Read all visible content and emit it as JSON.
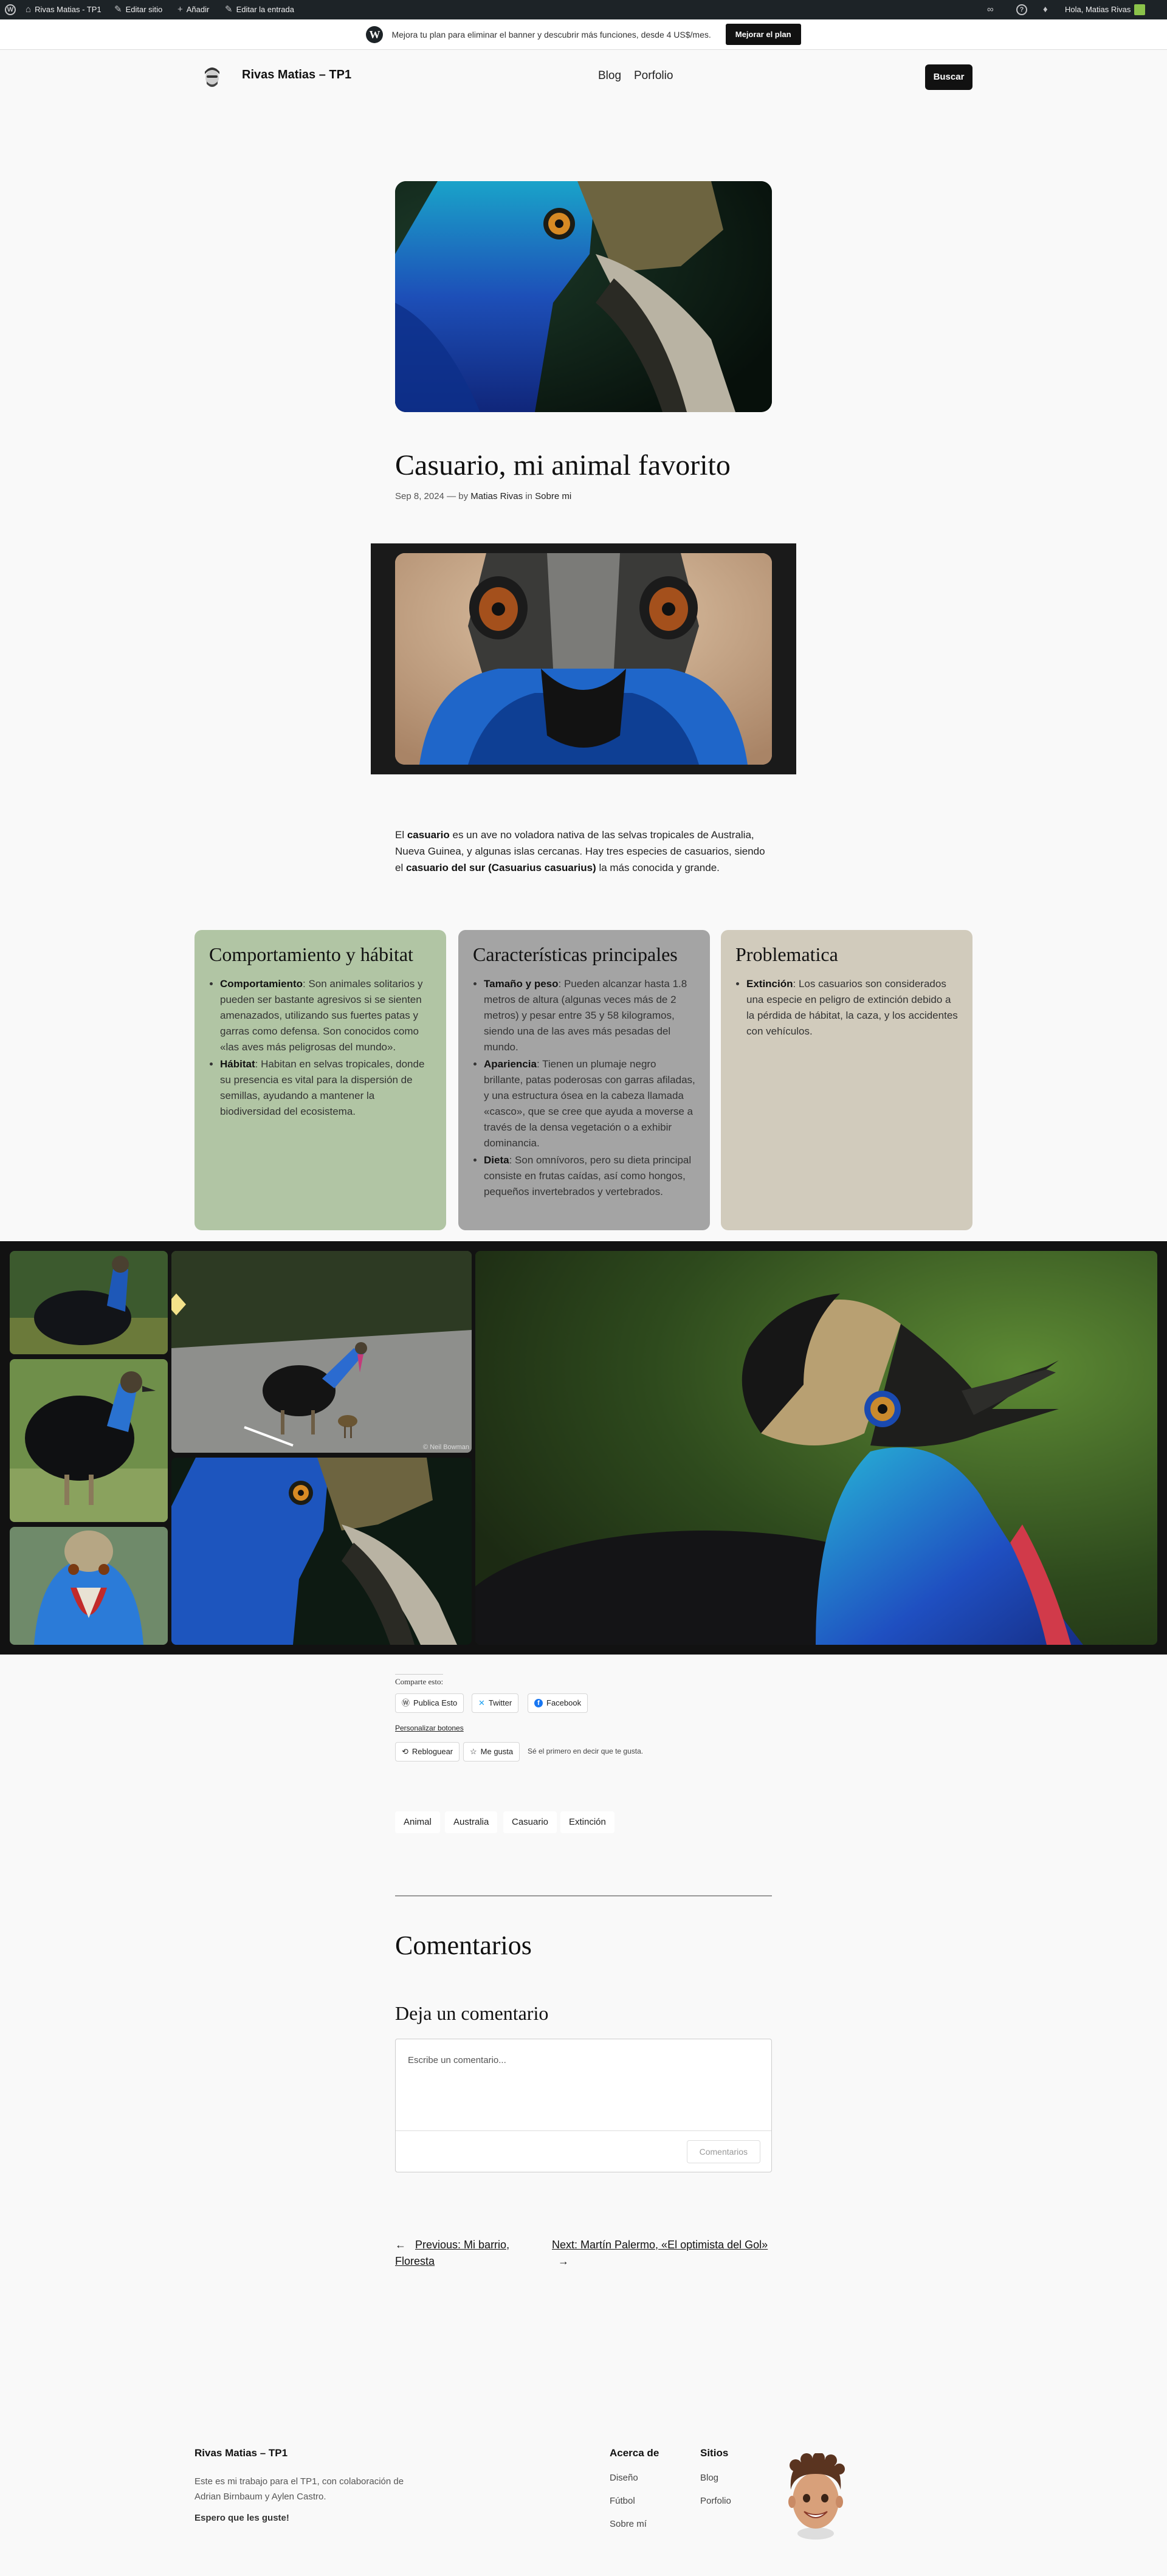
{
  "admin_bar": {
    "site_name": "Rivas Matias - TP1",
    "edit_site": "Editar sitio",
    "add_new": "Añadir",
    "edit_entry": "Editar la entrada",
    "greeting": "Hola, Matias Rivas"
  },
  "promo": {
    "text": "Mejora tu plan para eliminar el banner y descubrir más funciones, desde 4 US$/mes.",
    "button": "Mejorar el plan"
  },
  "header": {
    "site_title": "Rivas Matias – TP1",
    "nav": [
      "Blog",
      "Porfolio"
    ],
    "search_button": "Buscar"
  },
  "post": {
    "title": "Casuario, mi animal favorito",
    "date": "Sep 8, 2024",
    "by_sep": "— by",
    "author": "Matias Rivas",
    "in_word": "in",
    "category": "Sobre mi",
    "intro": {
      "p1": "El ",
      "b1": "casuario",
      "p2": " es un ave no voladora nativa de las selvas tropicales de Australia, Nueva Guinea, y algunas islas cercanas. Hay tres especies de casuarios, siendo el ",
      "b2": "casuario del sur (Casuarius casuarius)",
      "p3": " la más conocida y grande."
    }
  },
  "cards": [
    {
      "title": "Comportamiento y hábitat",
      "color": "#b1c5a4",
      "items": [
        {
          "term": "Comportamiento",
          "text": ": Son animales solitarios y pueden ser bastante agresivos si se sienten amenazados, utilizando sus fuertes patas y garras como defensa. Son conocidos como «las aves más peligrosas del mundo»."
        },
        {
          "term": "Hábitat",
          "text": ": Habitan en selvas tropicales, donde su presencia es vital para la dispersión de semillas, ayudando a mantener la biodiversidad del ecosistema."
        }
      ]
    },
    {
      "title": "Características principales",
      "color": "#a4a4a4",
      "items": [
        {
          "term": "Tamaño y peso",
          "text": ": Pueden alcanzar hasta 1.8 metros de altura (algunas veces más de 2 metros) y pesar entre 35 y 58 kilogramos, siendo una de las aves más pesadas del mundo."
        },
        {
          "term": "Apariencia",
          "text": ": Tienen un plumaje negro brillante, patas poderosas con garras afiladas, y una estructura ósea en la cabeza llamada «casco», que se cree que ayuda a moverse a través de la densa vegetación o a exhibir dominancia."
        },
        {
          "term": "Dieta",
          "text": ": Son omnívoros, pero su dieta principal consiste en frutas caídas, así como hongos, pequeños invertebrados y vertebrados."
        }
      ]
    },
    {
      "title": "Problematica",
      "color": "#d1cbbc",
      "items": [
        {
          "term": "Extinción",
          "text": ": Los casuarios son considerados una especie en peligro de extinción debido a la pérdida de hábitat, la caza, y los accidentes con vehículos."
        }
      ]
    }
  ],
  "gallery": {
    "photo_credit": "© Neil Bowman"
  },
  "sharing": {
    "heading": "Comparte esto:",
    "buttons": [
      "Publica Esto",
      "Twitter",
      "Facebook"
    ],
    "customize": "Personalizar botones",
    "reblog": "Rebloguear",
    "like": "Me gusta",
    "like_text": "Sé el primero en decir que te gusta."
  },
  "tags": [
    "Animal",
    "Australia",
    "Casuario",
    "Extinción"
  ],
  "comments": {
    "heading": "Comentarios",
    "reply_heading": "Deja un comentario",
    "placeholder": "Escribe un comentario...",
    "submit": "Comentarios"
  },
  "post_nav": {
    "prev_label": "Previous: Mi barrio,",
    "prev_label2": "Floresta",
    "next_label": "Next: Martín Palermo, «El optimista del Gol»",
    "prev_arrow": "←",
    "next_arrow": "→"
  },
  "footer": {
    "title": "Rivas Matias – TP1",
    "text": "Este es mi trabajo para el TP1, con colaboración de Adrian Birnbaum y Aylen Castro.",
    "strong": "Espero que les guste!",
    "col1_title": "Acerca de",
    "col1_links": [
      "Diseño",
      "Fútbol",
      "Sobre mí"
    ],
    "col2_title": "Sitios",
    "col2_links": [
      "Blog",
      "Porfolio"
    ]
  }
}
